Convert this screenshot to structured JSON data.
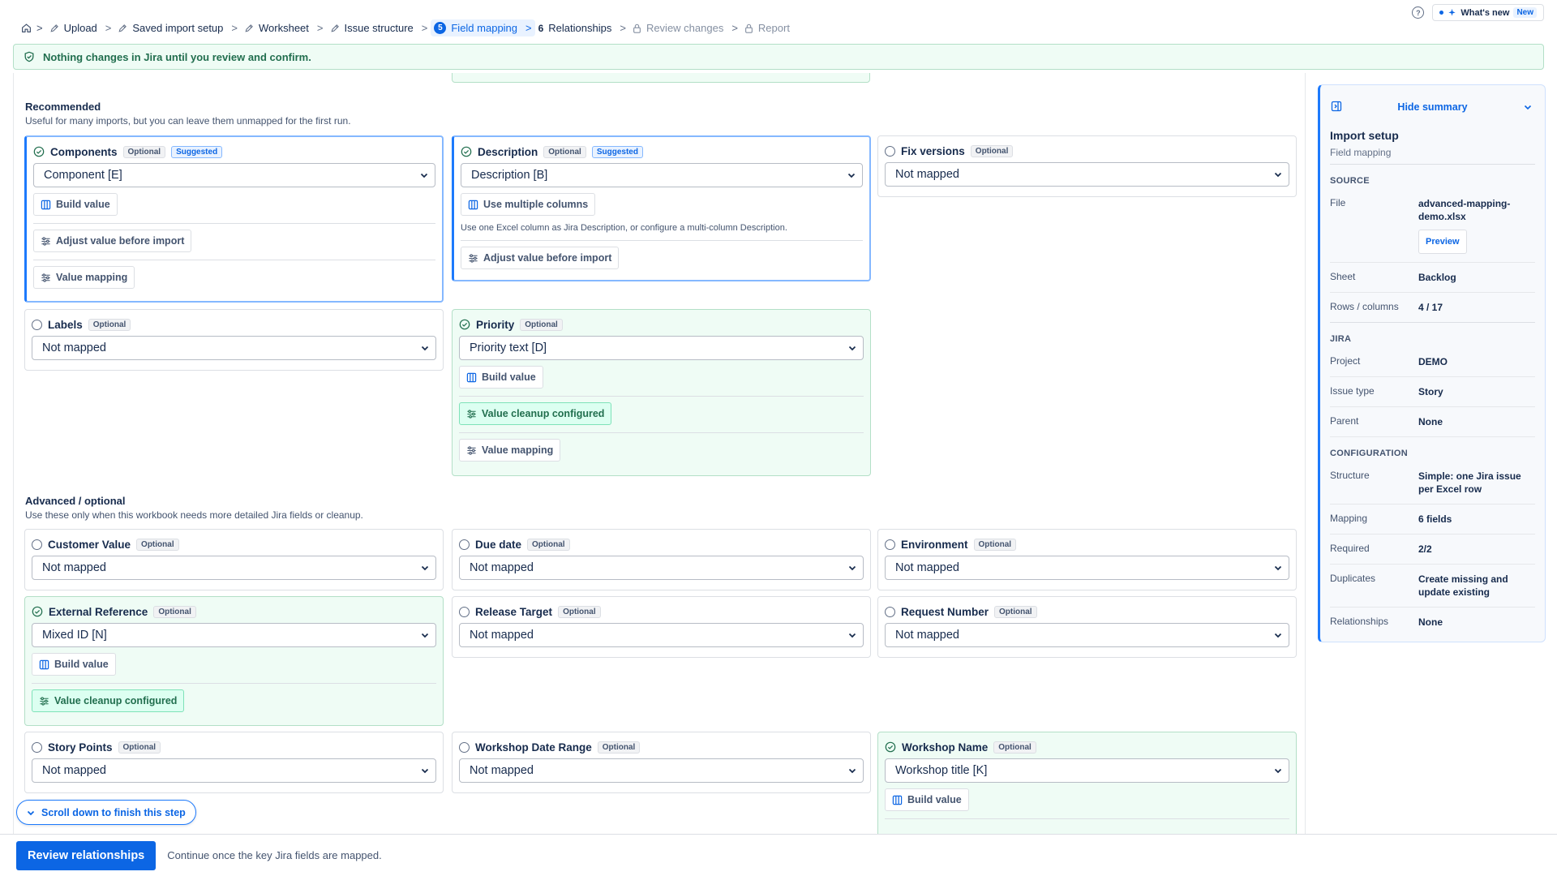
{
  "breadcrumbs": {
    "home_icon": "home-icon",
    "items": [
      {
        "label": "Upload",
        "state": "done"
      },
      {
        "label": "Saved import setup",
        "state": "done"
      },
      {
        "label": "Worksheet",
        "state": "done"
      },
      {
        "label": "Issue structure",
        "state": "done"
      },
      {
        "label": "Field mapping",
        "state": "active",
        "step": "5"
      },
      {
        "label": "Relationships",
        "state": "next",
        "step": "6"
      },
      {
        "label": "Review changes",
        "state": "locked"
      },
      {
        "label": "Report",
        "state": "locked"
      }
    ],
    "separator": ">"
  },
  "top_right": {
    "help": "?",
    "whats_new": "What's new",
    "new_badge": "New"
  },
  "banner": {
    "text": "Nothing changes in Jira until you review and confirm."
  },
  "recommended": {
    "title": "Recommended",
    "description": "Useful for many imports, but you can leave them unmapped for the first run."
  },
  "advanced": {
    "title": "Advanced / optional",
    "description": "Use these only when this workbook needs more detailed Jira fields or cleanup."
  },
  "fields": {
    "components": {
      "name": "Components",
      "badge": "Optional",
      "suggested": "Suggested",
      "value": "Component [E]",
      "build": "Build value",
      "adjust": "Adjust value before import",
      "mapping": "Value mapping"
    },
    "description": {
      "name": "Description",
      "badge": "Optional",
      "suggested": "Suggested",
      "value": "Description [B]",
      "multi": "Use multiple columns",
      "hint": "Use one Excel column as Jira Description, or configure a multi-column Description.",
      "adjust": "Adjust value before import"
    },
    "fix_versions": {
      "name": "Fix versions",
      "badge": "Optional",
      "value": "Not mapped"
    },
    "labels": {
      "name": "Labels",
      "badge": "Optional",
      "value": "Not mapped"
    },
    "priority": {
      "name": "Priority",
      "badge": "Optional",
      "value": "Priority text [D]",
      "build": "Build value",
      "cleanup": "Value cleanup configured",
      "mapping": "Value mapping"
    },
    "customer_value": {
      "name": "Customer Value",
      "badge": "Optional",
      "value": "Not mapped"
    },
    "due_date": {
      "name": "Due date",
      "badge": "Optional",
      "value": "Not mapped"
    },
    "environment": {
      "name": "Environment",
      "badge": "Optional",
      "value": "Not mapped"
    },
    "external_reference": {
      "name": "External Reference",
      "badge": "Optional",
      "value": "Mixed ID [N]",
      "build": "Build value",
      "cleanup": "Value cleanup configured"
    },
    "release_target": {
      "name": "Release Target",
      "badge": "Optional",
      "value": "Not mapped"
    },
    "request_number": {
      "name": "Request Number",
      "badge": "Optional",
      "value": "Not mapped"
    },
    "story_points": {
      "name": "Story Points",
      "badge": "Optional",
      "value": "Not mapped"
    },
    "workshop_date_range": {
      "name": "Workshop Date Range",
      "badge": "Optional",
      "value": "Not mapped"
    },
    "workshop_name": {
      "name": "Workshop Name",
      "badge": "Optional",
      "value": "Workshop title [K]",
      "build": "Build value"
    }
  },
  "summary": {
    "hide_label": "Hide summary",
    "title": "Import setup",
    "subtitle": "Field mapping",
    "source_title": "SOURCE",
    "file_label": "File",
    "file_value": "advanced-mapping-demo.xlsx",
    "preview": "Preview",
    "sheet_label": "Sheet",
    "sheet_value": "Backlog",
    "rows_label": "Rows / columns",
    "rows_value": "4 / 17",
    "jira_title": "JIRA",
    "project_label": "Project",
    "project_value": "DEMO",
    "issue_type_label": "Issue type",
    "issue_type_value": "Story",
    "parent_label": "Parent",
    "parent_value": "None",
    "config_title": "CONFIGURATION",
    "structure_label": "Structure",
    "structure_value": "Simple: one Jira issue per Excel row",
    "mapping_label": "Mapping",
    "mapping_value": "6 fields",
    "required_label": "Required",
    "required_value": "2/2",
    "duplicates_label": "Duplicates",
    "duplicates_value": "Create missing and update existing",
    "relationships_label": "Relationships",
    "relationships_value": "None"
  },
  "scroll_hint": "Scroll down to finish this step",
  "footer": {
    "primary": "Review relationships",
    "hint": "Continue once the key Jira fields are mapped."
  },
  "colors": {
    "accent": "#0c66e4",
    "success_bg": "#effcf5",
    "success_text": "#216e4e"
  }
}
